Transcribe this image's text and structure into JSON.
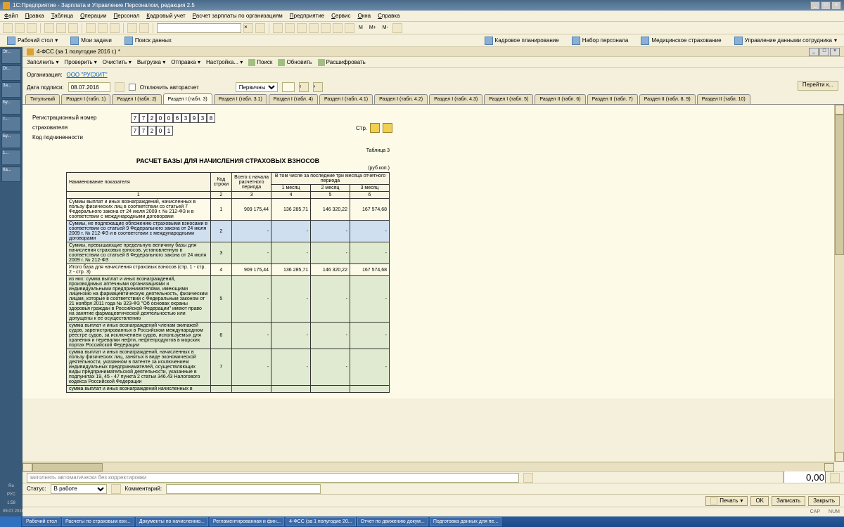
{
  "window": {
    "title": "1С:Предприятие - Зарплата и Управление Персоналом, редакция 2.5"
  },
  "menu": [
    "Файл",
    "Правка",
    "Таблица",
    "Операции",
    "Персонал",
    "Кадровый учет",
    "Расчет зарплаты по организациям",
    "Предприятие",
    "Сервис",
    "Окна",
    "Справка"
  ],
  "toolbar_m": [
    "M",
    "M+",
    "M-"
  ],
  "toolbar2": {
    "desktop": "Рабочий стол",
    "tasks": "Мои задачи",
    "search": "Поиск данных",
    "planning": "Кадровое планирование",
    "hiring": "Набор персонала",
    "med": "Медицинское страхование",
    "mgmt": "Управление данными сотрудника"
  },
  "side_tabs": [
    "Эт...",
    "Dr...",
    "За...",
    "Бу...",
    "Т...",
    "Бу...",
    "1...",
    "Ка..."
  ],
  "side_bottom": [
    "Ru",
    "РУС",
    "1:58",
    "09.07.2016"
  ],
  "doc": {
    "title": "4-ФСС (за 1 полугодие 2016 г.) *",
    "actions": [
      "Заполнить",
      "Проверить",
      "Очистить",
      "Выгрузка",
      "Отправка",
      "Настройка...",
      "Поиск",
      "Обновить",
      "Расшифровать"
    ],
    "org_label": "Организация:",
    "org": "ООО \"РУСХИТ\"",
    "date_label": "Дата подписи:",
    "date": "08.07.2016",
    "chk_label": "Отключить авторасчет",
    "primary": "Первичный",
    "goto": "Перейти к..."
  },
  "tabs": [
    "Титульный",
    "Раздел I (табл. 1)",
    "Раздел I (табл. 2)",
    "Раздел I (табл. 3)",
    "Раздел I (табл. 3.1)",
    "Раздел I (табл. 4)",
    "Раздел I (табл. 4.1)",
    "Раздел I (табл. 4.2)",
    "Раздел I (табл. 4.3)",
    "Раздел I (табл. 5)",
    "Раздел II (табл. 6)",
    "Раздел II (табл. 7)",
    "Раздел II (табл. 8, 9)",
    "Раздел II (табл. 10)"
  ],
  "active_tab": 3,
  "reg": {
    "label1": "Регистрационный номер страхователя",
    "digits1": [
      "7",
      "7",
      "2",
      "0",
      "0",
      "6",
      "3",
      "9",
      "3",
      "8"
    ],
    "label2": "Код подчиненности",
    "digits2": [
      "7",
      "7",
      "2",
      "0",
      "1"
    ],
    "page_label": "Стр."
  },
  "table": {
    "title": "РАСЧЕТ БАЗЫ ДЛЯ НАЧИСЛЕНИЯ СТРАХОВЫХ ВЗНОСОВ",
    "num": "Таблица 3",
    "unit": "(руб.коп.)",
    "h_name": "Наименование показателя",
    "h_code": "Код строки",
    "h_total": "Всего с начала расчетного периода",
    "h_months": "В том числе за последние три месяца отчетного периода",
    "m1": "1 месяц",
    "m2": "2 месяц",
    "m3": "3 месяц",
    "c1": "1",
    "c2": "2",
    "c3": "3",
    "c4": "4",
    "c5": "5",
    "c6": "6",
    "rows": [
      {
        "desc": "Суммы выплат и иных вознаграждений, начисленных в пользу физических лиц в соответствии со статьей 7 Федерального закона от 24 июля 2009 г. № 212-ФЗ и в соответствии с международными договорами",
        "code": "1",
        "v": [
          "909 175,44",
          "136 285,71",
          "146 320,22",
          "167 574,68"
        ],
        "green": false
      },
      {
        "desc": "Суммы, не подлежащие обложению страховыми взносами в соответствии со статьей 9 Федерального закона от 24 июля 2009 г. № 212-ФЗ и в соответствии с международными договорами",
        "code": "2",
        "v": [
          "-",
          "-",
          "-",
          "-"
        ],
        "green": true,
        "sel": true
      },
      {
        "desc": "Суммы, превышающие предельную величину базы для начисления страховых взносов, установленную в соответствии со статьей 8 Федерального закона от 24 июля 2009 г. № 212-ФЗ",
        "code": "3",
        "v": [
          "-",
          "-",
          "-",
          "-"
        ],
        "green": true
      },
      {
        "desc": "Итого база для начисления страховых взносов (стр. 1 - стр. 2 - стр. 3)",
        "code": "4",
        "v": [
          "909 175,44",
          "136 285,71",
          "146 320,22",
          "167 574,68"
        ],
        "green": false
      },
      {
        "desc": "из них:\n   сумма выплат и иных вознаграждений, производимых аптечными организациями и индивидуальными предпринимателями, имеющими лицензию на фармацевтическую деятельность, физическим лицам, которые в соответствии с Федеральным законом от 21 ноября 2011 года № 323-ФЗ \"Об основах охраны здоровья граждан в Российской Федерации\" имеют право на занятие фармацевтической деятельностью или допущены к ее осуществлению",
        "code": "5",
        "v": [
          "-",
          "-",
          "-",
          "-"
        ],
        "green": true
      },
      {
        "desc": "   сумма выплат и иных вознаграждений членам экипажей судов, зарегистрированных в Российском международном реестре судов, за исключением судов, используемых для хранения и перевалки нефти, нефтепродуктов в морских портах Российской Федерации",
        "code": "6",
        "v": [
          "-",
          "-",
          "-",
          "-"
        ],
        "green": true
      },
      {
        "desc": "   сумма выплат и иных вознаграждений, начисленных в пользу физических лиц, занятых в виде экономической деятельности, указанном в патенте за исключением индивидуальных предпринимателей, осуществляющих виды предпринимательской деятельности, указанные в подпунктах 19, 45 - 47 пункта 2 статьи 346.43 Налогового кодекса Российской Федерации",
        "code": "7",
        "v": [
          "-",
          "-",
          "-",
          "-"
        ],
        "green": true
      },
      {
        "desc": "   сумма выплат и иных вознаграждений начисленных в",
        "code": "",
        "v": [
          "",
          "",
          "",
          ""
        ],
        "green": true
      }
    ]
  },
  "opt_row": {
    "placeholder": "заполнять автоматически без корректировки",
    "val": "0,00"
  },
  "fwd": {
    "status_label": "Статус:",
    "status": "В работе",
    "comment_label": "Комментарий:"
  },
  "bottom": {
    "print": "Печать",
    "ok": "OK",
    "save": "Записать",
    "close": "Закрыть"
  },
  "footer_tasks": [
    "Рабочий стол",
    "Расчеты по страховым взн...",
    "Документы по начислению...",
    "Регламентированная и фин...",
    "4-ФСС (за 1 полугодие 20...",
    "Отчет по движению докум...",
    "Подготовка данных для пе..."
  ],
  "app_status": {
    "cap": "CAP",
    "num": "NUM"
  }
}
